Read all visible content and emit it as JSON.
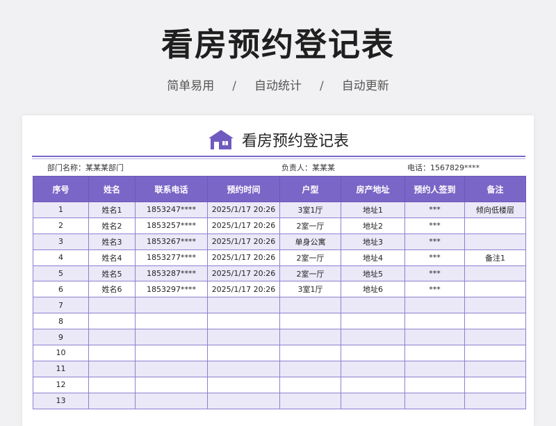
{
  "page": {
    "title": "看房预约登记表",
    "tags": [
      "简单易用",
      "自动统计",
      "自动更新"
    ],
    "separator": "/"
  },
  "sheet": {
    "title": "看房预约登记表",
    "icon": "house-icon",
    "accent_color": "#7a66c6",
    "dept": "部门名称：某某某部门",
    "owner": "负责人：某某某",
    "phone": "电话：1567829****"
  },
  "table": {
    "headers": [
      "序号",
      "姓名",
      "联系电话",
      "预约时间",
      "户型",
      "房产地址",
      "预约人签到",
      "备注"
    ],
    "rows": [
      [
        "1",
        "姓名1",
        "1853247****",
        "2025/1/17 20:26",
        "3室1厅",
        "地址1",
        "***",
        "倾向低楼层"
      ],
      [
        "2",
        "姓名2",
        "1853257****",
        "2025/1/17 20:26",
        "2室一厅",
        "地址2",
        "***",
        ""
      ],
      [
        "3",
        "姓名3",
        "1853267****",
        "2025/1/17 20:26",
        "单身公寓",
        "地址3",
        "***",
        ""
      ],
      [
        "4",
        "姓名4",
        "1853277****",
        "2025/1/17 20:26",
        "2室一厅",
        "地址4",
        "***",
        "备注1"
      ],
      [
        "5",
        "姓名5",
        "1853287****",
        "2025/1/17 20:26",
        "2室一厅",
        "地址5",
        "***",
        ""
      ],
      [
        "6",
        "姓名6",
        "1853297****",
        "2025/1/17 20:26",
        "3室1厅",
        "地址6",
        "***",
        ""
      ],
      [
        "7",
        "",
        "",
        "",
        "",
        "",
        "",
        ""
      ],
      [
        "8",
        "",
        "",
        "",
        "",
        "",
        "",
        ""
      ],
      [
        "9",
        "",
        "",
        "",
        "",
        "",
        "",
        ""
      ],
      [
        "10",
        "",
        "",
        "",
        "",
        "",
        "",
        ""
      ],
      [
        "11",
        "",
        "",
        "",
        "",
        "",
        "",
        ""
      ],
      [
        "12",
        "",
        "",
        "",
        "",
        "",
        "",
        ""
      ],
      [
        "13",
        "",
        "",
        "",
        "",
        "",
        "",
        ""
      ]
    ]
  }
}
